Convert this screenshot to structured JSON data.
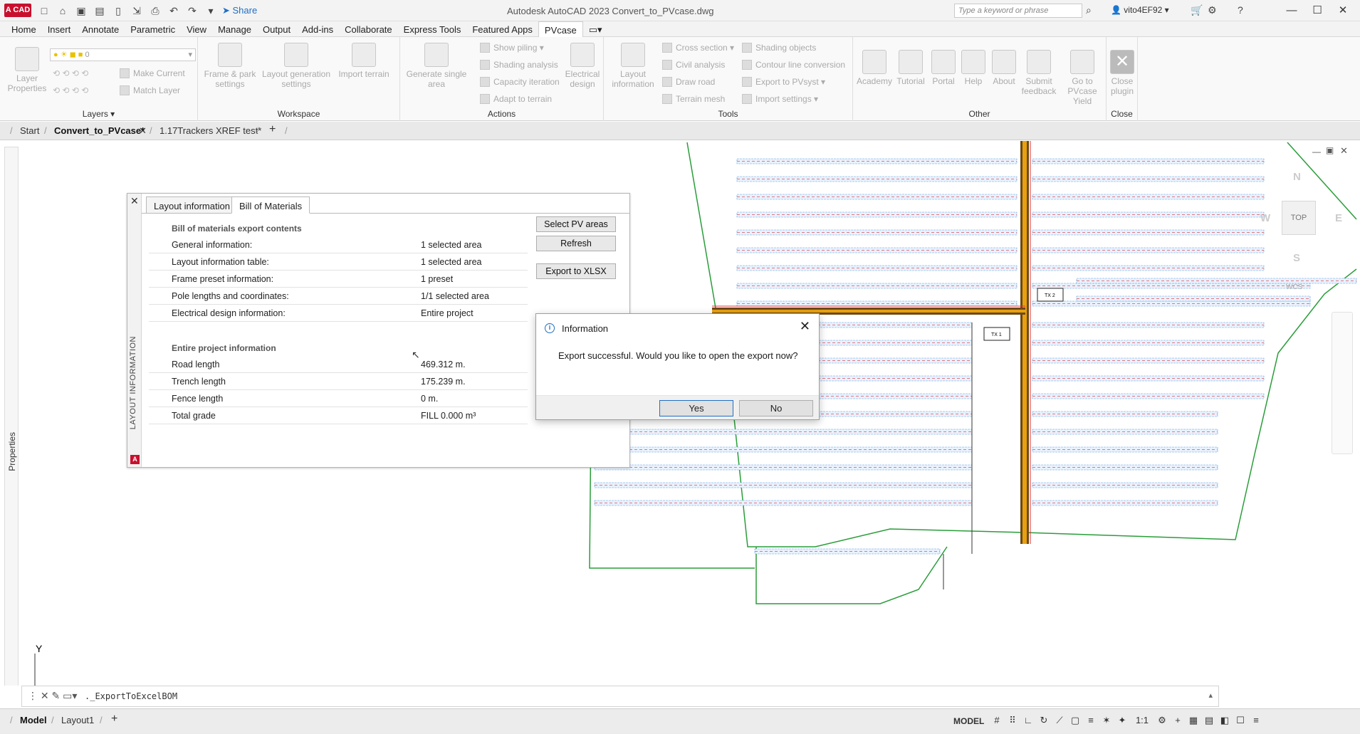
{
  "app": {
    "logo": "A CAD",
    "window_title": "Autodesk AutoCAD 2023   Convert_to_PVcase.dwg",
    "share_label": "Share",
    "search_placeholder": "Type a keyword or phrase",
    "user": "vito4EF92"
  },
  "ribbon_tabs": [
    "Home",
    "Insert",
    "Annotate",
    "Parametric",
    "View",
    "Manage",
    "Output",
    "Add-ins",
    "Collaborate",
    "Express Tools",
    "Featured Apps",
    "PVcase"
  ],
  "ribbon": {
    "layers": {
      "title": "Layers",
      "layer_properties": "Layer Properties",
      "layer_value": "0",
      "make_current": "Make Current",
      "match_layer": "Match Layer"
    },
    "workspace": {
      "title": "Workspace",
      "frame_park": "Frame & park settings",
      "layout_generation": "Layout generation settings",
      "import_terrain": "Import terrain"
    },
    "actions": {
      "title": "Actions",
      "generate_single_area": "Generate single area",
      "show_piling": "Show piling",
      "shading_analysis": "Shading analysis",
      "capacity_iteration": "Capacity iteration",
      "adapt_to_terrain": "Adapt to terrain",
      "electrical_design": "Electrical design"
    },
    "tools": {
      "title": "Tools",
      "layout_information": "Layout information",
      "cross_section": "Cross section",
      "civil_analysis": "Civil analysis",
      "draw_road": "Draw road",
      "terrain_mesh": "Terrain mesh",
      "shading_objects": "Shading objects",
      "contour_line_conversion": "Contour line conversion",
      "export_to_pvsyst": "Export to PVsyst",
      "import_settings": "Import settings"
    },
    "other": {
      "title": "Other",
      "academy": "Academy",
      "tutorial": "Tutorial",
      "portal": "Portal",
      "help": "Help",
      "about": "About",
      "submit_feedback": "Submit feedback",
      "go_to_yield": "Go to PVcase Yield"
    },
    "close": {
      "title": "Close",
      "close_plugin": "Close plugin"
    }
  },
  "file_tabs": [
    "Start",
    "Convert_to_PVcase*",
    "1.17Trackers XREF test*"
  ],
  "layout_panel": {
    "side_title": "LAYOUT INFORMATION",
    "tabs": [
      "Layout information",
      "Bill of Materials"
    ],
    "export_section": "Bill of materials export contents",
    "export_rows": [
      {
        "key": "General information:",
        "value": "1 selected area"
      },
      {
        "key": "Layout information table:",
        "value": "1 selected area"
      },
      {
        "key": "Frame preset information:",
        "value": "1 preset"
      },
      {
        "key": "Pole lengths and coordinates:",
        "value": "1/1 selected area"
      },
      {
        "key": "Electrical design information:",
        "value": "Entire project"
      }
    ],
    "project_section": "Entire project information",
    "project_rows": [
      {
        "key": "Road length",
        "value": "469.312 m."
      },
      {
        "key": "Trench length",
        "value": "175.239 m."
      },
      {
        "key": "Fence length",
        "value": "0 m."
      },
      {
        "key": "Total grade",
        "value": "FILL 0.000 m³"
      }
    ],
    "buttons": {
      "select_pv_areas": "Select PV areas",
      "refresh": "Refresh",
      "export_xlsx": "Export to XLSX"
    }
  },
  "info_dialog": {
    "title": "Information",
    "message": "Export successful. Would you like to open the export now?",
    "yes": "Yes",
    "no": "No"
  },
  "drawing": {
    "tx1": "TX 1",
    "tx2": "TX 2",
    "viewcube_top": "TOP",
    "compass_n": "N",
    "compass_s": "S",
    "compass_e": "E",
    "compass_w": "W",
    "wcs": "WCS",
    "axis_y": "Y"
  },
  "command_line": {
    "text": "._ExportToExcelBOM"
  },
  "status": {
    "layout_tabs": [
      "Model",
      "Layout1"
    ],
    "model_label": "MODEL",
    "scale": "1:1"
  },
  "properties_label": "Properties"
}
